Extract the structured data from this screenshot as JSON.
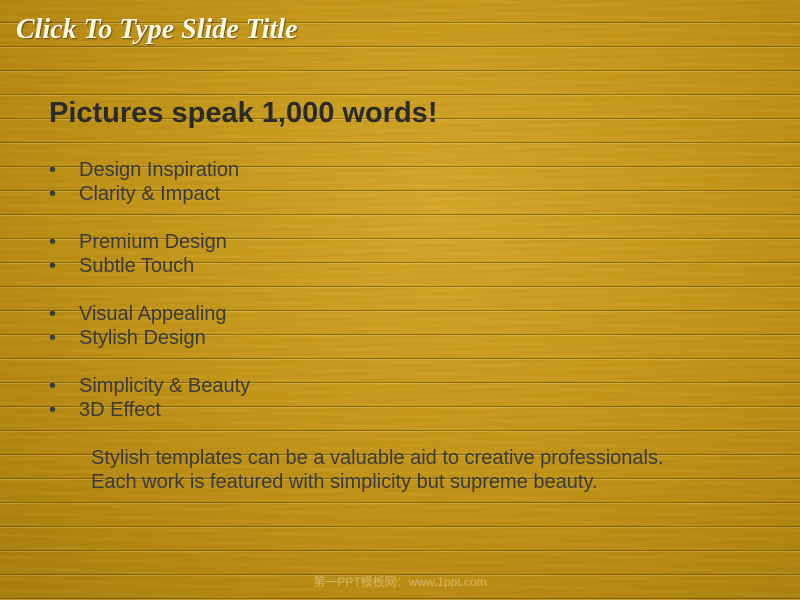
{
  "slide": {
    "title": "Click To Type Slide Title",
    "heading": "Pictures speak 1,000 words!",
    "bullet_char": "•",
    "bullet_groups": [
      [
        "Design Inspiration",
        "Clarity & Impact"
      ],
      [
        "Premium Design",
        "Subtle Touch"
      ],
      [
        "Visual Appealing",
        "Stylish Design"
      ],
      [
        "Simplicity & Beauty",
        "3D Effect"
      ]
    ],
    "note_lines": [
      "Stylish templates can be a valuable aid to creative professionals.",
      "Each work is featured with simplicity but supreme beauty."
    ],
    "footer": "第一PPT模板网：www.1ppt.com"
  }
}
